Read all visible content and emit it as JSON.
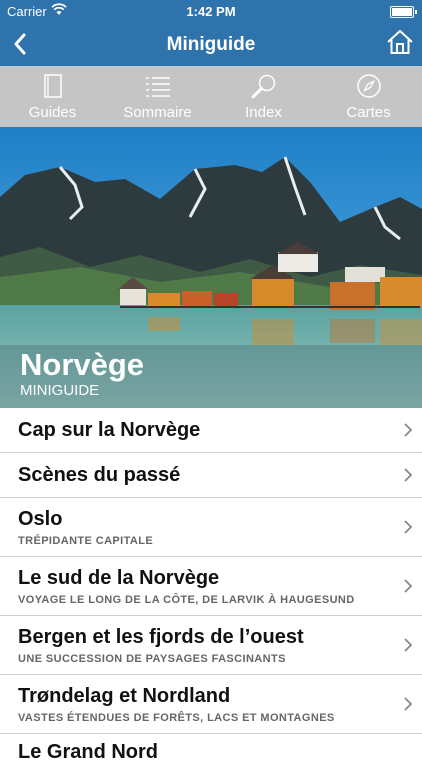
{
  "status": {
    "carrier": "Carrier",
    "time": "1:42 PM"
  },
  "navbar": {
    "title": "Miniguide",
    "back_icon": "chevron-left-icon",
    "home_icon": "home-icon"
  },
  "tabs": [
    {
      "label": "Guides",
      "icon": "book-icon"
    },
    {
      "label": "Sommaire",
      "icon": "list-icon"
    },
    {
      "label": "Index",
      "icon": "magnifier-icon"
    },
    {
      "label": "Cartes",
      "icon": "compass-icon"
    }
  ],
  "hero": {
    "title": "Norvège",
    "subtitle": "MINIGUIDE"
  },
  "list": [
    {
      "title": "Cap sur la Norvège",
      "subtitle": ""
    },
    {
      "title": "Scènes du passé",
      "subtitle": ""
    },
    {
      "title": "Oslo",
      "subtitle": "TRÉPIDANTE CAPITALE"
    },
    {
      "title": "Le sud de la Norvège",
      "subtitle": "VOYAGE LE LONG DE LA CÔTE, DE LARVIK À HAUGESUND"
    },
    {
      "title": "Bergen et les fjords de l’ouest",
      "subtitle": "UNE SUCCESSION DE PAYSAGES FASCINANTS"
    },
    {
      "title": "Trøndelag et Nordland",
      "subtitle": "VASTES ÉTENDUES DE FORÊTS, LACS ET MONTAGNES"
    },
    {
      "title": "Le Grand Nord",
      "subtitle": ""
    }
  ],
  "colors": {
    "accent": "#2f73ad",
    "tabbar": "#c5c5c5"
  }
}
